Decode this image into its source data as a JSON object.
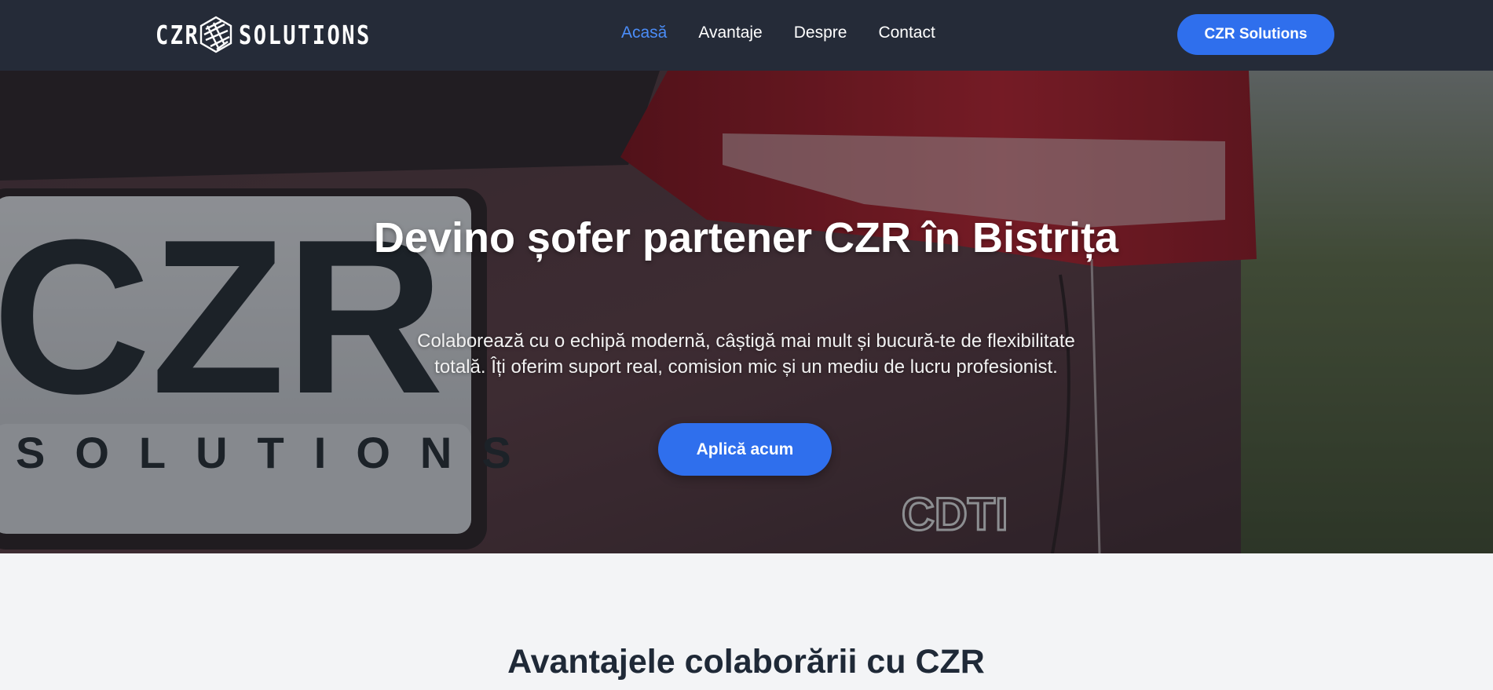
{
  "brand": {
    "logo_left": "CZR",
    "logo_right": "SOLUTIONS"
  },
  "nav": {
    "links": [
      {
        "label": "Acasă",
        "active": true
      },
      {
        "label": "Avantaje",
        "active": false
      },
      {
        "label": "Despre",
        "active": false
      },
      {
        "label": "Contact",
        "active": false
      }
    ],
    "cta_label": "CZR Solutions"
  },
  "hero": {
    "title": "Devino șofer partener CZR în Bistrița",
    "subtitle": "Colaborează cu o echipă modernă, câștigă mai mult și bucură-te de flexibilitate totală. Îți oferim suport real, comision mic și un mediu de lucru profesionist.",
    "cta_label": "Aplică acum",
    "plate_main": "CZR",
    "plate_sub": "SOLUTIONS",
    "badge": "CDTI"
  },
  "advantages": {
    "title": "Avantajele colaborării cu CZR"
  },
  "colors": {
    "navbar_bg": "#252b38",
    "accent": "#2f6fed",
    "active_link": "#4b8df8",
    "section_bg": "#f3f4f6",
    "heading_dark": "#1f2937"
  },
  "icons": {
    "logo_mark": "hexagon-swirl-icon"
  }
}
